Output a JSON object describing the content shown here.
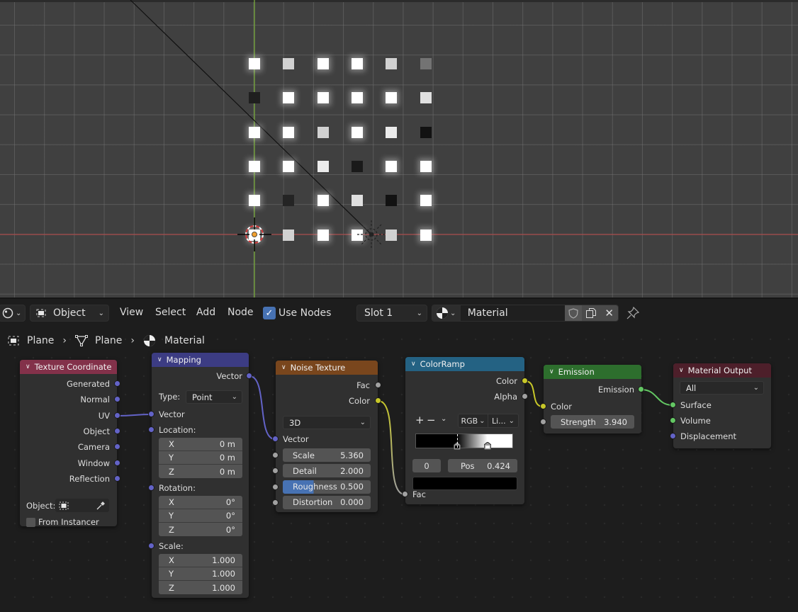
{
  "viewport": {
    "grid_tiles": [
      [
        1.0,
        0.82,
        1.0,
        1.0,
        0.82,
        0.45
      ],
      [
        0.12,
        1.0,
        1.0,
        1.0,
        1.0,
        0.88
      ],
      [
        1.0,
        1.0,
        0.82,
        1.0,
        0.92,
        0.07
      ],
      [
        1.0,
        1.0,
        0.92,
        0.1,
        1.0,
        1.0
      ],
      [
        1.0,
        0.14,
        1.0,
        0.88,
        0.07,
        1.0
      ],
      [
        1.0,
        0.82,
        1.0,
        1.0,
        0.82,
        1.0
      ]
    ]
  },
  "header": {
    "editor_type_icon": "node-editor-icon",
    "mode": "Object",
    "menus": [
      "View",
      "Select",
      "Add",
      "Node"
    ],
    "use_nodes_label": "Use Nodes",
    "use_nodes_checked": true,
    "slot": "Slot 1",
    "material_name": "Material",
    "icons": [
      "fake-user-shield-icon",
      "duplicate-icon",
      "unlink-x-icon",
      "pin-icon"
    ]
  },
  "breadcrumb": [
    {
      "icon": "object-icon",
      "label": "Plane"
    },
    {
      "icon": "mesh-icon",
      "label": "Plane"
    },
    {
      "icon": "material-icon",
      "label": "Material"
    }
  ],
  "nodes": {
    "texcoord": {
      "title": "Texture Coordinate",
      "color": "#83314a",
      "outputs": [
        "Generated",
        "Normal",
        "UV",
        "Object",
        "Camera",
        "Window",
        "Reflection"
      ],
      "object_label": "Object:",
      "from_instancer": "From Instancer",
      "from_instancer_checked": false
    },
    "mapping": {
      "title": "Mapping",
      "color": "#3c3c83",
      "output": "Vector",
      "type_label": "Type:",
      "type_value": "Point",
      "vector_label": "Vector",
      "location_label": "Location:",
      "location": [
        {
          "axis": "X",
          "value": "0 m"
        },
        {
          "axis": "Y",
          "value": "0 m"
        },
        {
          "axis": "Z",
          "value": "0 m"
        }
      ],
      "rotation_label": "Rotation:",
      "rotation": [
        {
          "axis": "X",
          "value": "0°"
        },
        {
          "axis": "Y",
          "value": "0°"
        },
        {
          "axis": "Z",
          "value": "0°"
        }
      ],
      "scale_label": "Scale:",
      "scale": [
        {
          "axis": "X",
          "value": "1.000"
        },
        {
          "axis": "Y",
          "value": "1.000"
        },
        {
          "axis": "Z",
          "value": "1.000"
        }
      ]
    },
    "noise": {
      "title": "Noise Texture",
      "color": "#79461d",
      "outputs": [
        "Fac",
        "Color"
      ],
      "dimensions": "3D",
      "vector_label": "Vector",
      "fields": [
        {
          "label": "Scale",
          "value": "5.360"
        },
        {
          "label": "Detail",
          "value": "2.000"
        },
        {
          "label": "Roughness",
          "value": "0.500",
          "fill": 0.5
        },
        {
          "label": "Distortion",
          "value": "0.000"
        }
      ]
    },
    "colorramp": {
      "title": "ColorRamp",
      "color": "#246283",
      "outputs": [
        "Color",
        "Alpha"
      ],
      "add": "+",
      "remove": "−",
      "color_mode": "RGB",
      "interpolation": "Li...",
      "stops": [
        {
          "pos": 0.424,
          "color": "#000000"
        },
        {
          "pos": 0.74,
          "color": "#ffffff"
        }
      ],
      "active_index": "0",
      "pos_label": "Pos",
      "pos_value": "0.424",
      "active_color": "#000000",
      "input": "Fac"
    },
    "emission": {
      "title": "Emission",
      "color": "#2d6e2d",
      "output": "Emission",
      "color_input": "Color",
      "strength_label": "Strength",
      "strength_value": "3.940"
    },
    "output": {
      "title": "Material Output",
      "color": "#4d1f2a",
      "target": "All",
      "inputs": [
        "Surface",
        "Volume",
        "Displacement"
      ]
    }
  }
}
